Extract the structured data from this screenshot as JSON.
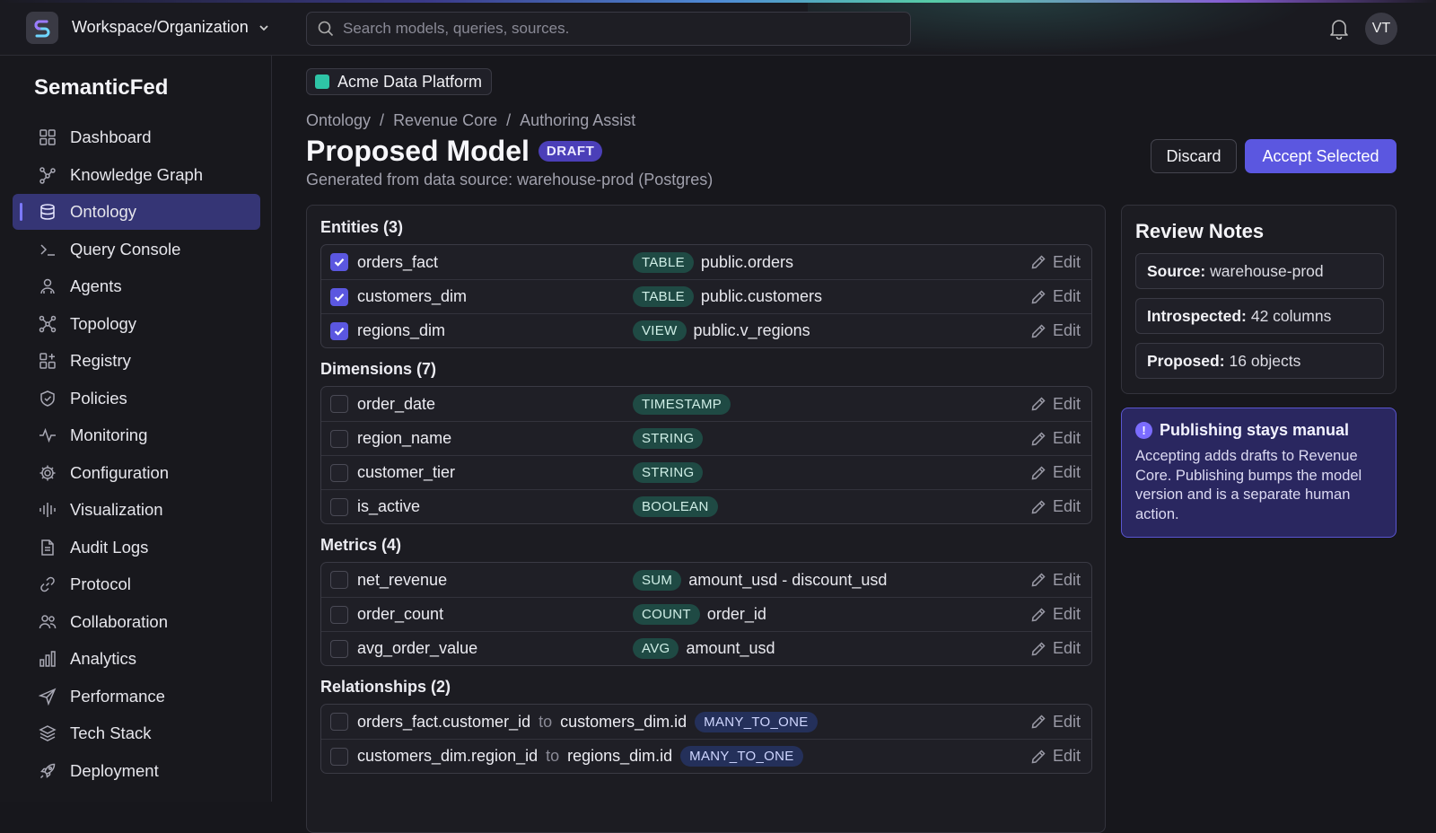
{
  "header": {
    "workspace": "Workspace/Organization",
    "search_placeholder": "Search models, queries, sources.",
    "avatar_initials": "VT"
  },
  "sidebar": {
    "brand": "SemanticFed",
    "items": [
      {
        "label": "Dashboard",
        "icon": "grid-icon"
      },
      {
        "label": "Knowledge Graph",
        "icon": "graph-icon"
      },
      {
        "label": "Ontology",
        "icon": "database-icon",
        "active": true
      },
      {
        "label": "Query Console",
        "icon": "terminal-icon"
      },
      {
        "label": "Agents",
        "icon": "users-icon"
      },
      {
        "label": "Topology",
        "icon": "network-icon"
      },
      {
        "label": "Registry",
        "icon": "registry-icon"
      },
      {
        "label": "Policies",
        "icon": "shield-icon"
      },
      {
        "label": "Monitoring",
        "icon": "pulse-icon"
      },
      {
        "label": "Configuration",
        "icon": "gear-icon"
      },
      {
        "label": "Visualization",
        "icon": "waveform-icon"
      },
      {
        "label": "Audit Logs",
        "icon": "document-icon"
      },
      {
        "label": "Protocol",
        "icon": "link-icon"
      },
      {
        "label": "Collaboration",
        "icon": "team-icon"
      },
      {
        "label": "Analytics",
        "icon": "bar-chart-icon"
      },
      {
        "label": "Performance",
        "icon": "send-icon"
      },
      {
        "label": "Tech Stack",
        "icon": "layers-icon"
      },
      {
        "label": "Deployment",
        "icon": "rocket-icon"
      }
    ]
  },
  "page": {
    "project": "Acme Data Platform",
    "breadcrumb": [
      "Ontology",
      "Revenue Core",
      "Authoring Assist"
    ],
    "title": "Proposed Model",
    "badge": "DRAFT",
    "subtitle": "Generated from data source: warehouse-prod (Postgres)",
    "discard_label": "Discard",
    "accept_label": "Accept Selected",
    "edit_label": "Edit"
  },
  "sections": {
    "entities": {
      "title": "Entities (3)",
      "rows": [
        {
          "name": "orders_fact",
          "tag": "TABLE",
          "detail": "public.orders",
          "checked": true
        },
        {
          "name": "customers_dim",
          "tag": "TABLE",
          "detail": "public.customers",
          "checked": true
        },
        {
          "name": "regions_dim",
          "tag": "VIEW",
          "detail": "public.v_regions",
          "checked": true
        }
      ]
    },
    "dimensions": {
      "title": "Dimensions (7)",
      "rows": [
        {
          "name": "order_date",
          "tag": "TIMESTAMP",
          "detail": "",
          "checked": false
        },
        {
          "name": "region_name",
          "tag": "STRING",
          "detail": "",
          "checked": false
        },
        {
          "name": "customer_tier",
          "tag": "STRING",
          "detail": "",
          "checked": false
        },
        {
          "name": "is_active",
          "tag": "BOOLEAN",
          "detail": "",
          "checked": false
        }
      ]
    },
    "metrics": {
      "title": "Metrics (4)",
      "rows": [
        {
          "name": "net_revenue",
          "tag": "SUM",
          "detail": "amount_usd - discount_usd",
          "checked": false
        },
        {
          "name": "order_count",
          "tag": "COUNT",
          "detail": "order_id",
          "checked": false
        },
        {
          "name": "avg_order_value",
          "tag": "AVG",
          "detail": "amount_usd",
          "checked": false
        }
      ]
    },
    "relationships": {
      "title": "Relationships (2)",
      "connector": "to",
      "rows": [
        {
          "from": "orders_fact.customer_id",
          "to": "customers_dim.id",
          "tag": "MANY_TO_ONE",
          "checked": false
        },
        {
          "from": "customers_dim.region_id",
          "to": "regions_dim.id",
          "tag": "MANY_TO_ONE",
          "checked": false
        }
      ]
    }
  },
  "review_notes": {
    "title": "Review Notes",
    "items": [
      {
        "label": "Source:",
        "value": "warehouse-prod"
      },
      {
        "label": "Introspected:",
        "value": "42 columns"
      },
      {
        "label": "Proposed:",
        "value": "16 objects"
      }
    ]
  },
  "info_box": {
    "icon": "!",
    "title": "Publishing stays manual",
    "body": "Accepting adds drafts to Revenue Core. Publishing bumps the model version and is a separate human action."
  },
  "colors": {
    "accent": "#5b57e0",
    "active_nav": "#353575",
    "tag_teal": "#1f4a44",
    "tag_blue": "#24305a",
    "info_bg": "#2a2760"
  }
}
